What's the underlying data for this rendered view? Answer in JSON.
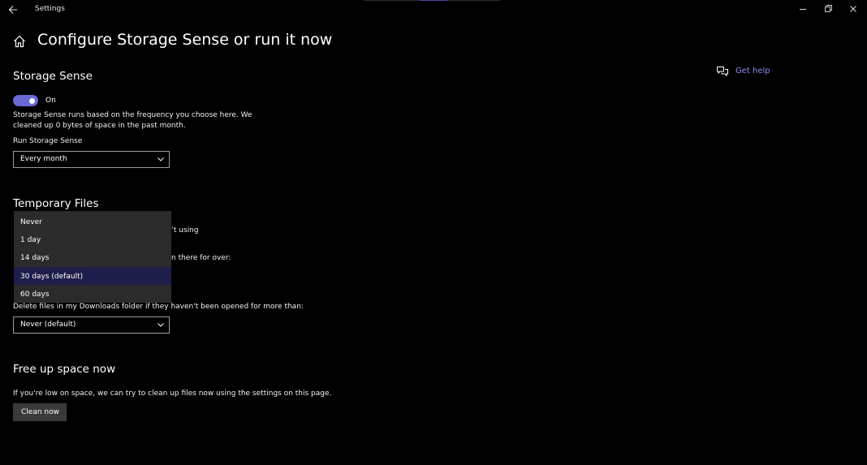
{
  "window": {
    "title": "Settings",
    "back_icon": "back-arrow-icon",
    "minimize_icon": "minimize-icon",
    "restore_icon": "restore-icon",
    "close_icon": "close-icon"
  },
  "header": {
    "home_icon": "home-icon",
    "title": "Configure Storage Sense or run it now"
  },
  "help": {
    "icon": "chat-help-icon",
    "label": "Get help",
    "color": "#8d8df0"
  },
  "storage_sense": {
    "heading": "Storage Sense",
    "toggle_state": "On",
    "toggle_on": true,
    "accent_color": "#6b69d6",
    "description_line1": "Storage Sense runs based on the frequency you choose here. We",
    "description_line2": "cleaned up 0 bytes of space in the past month.",
    "run_label": "Run Storage Sense",
    "run_value": "Every month"
  },
  "temporary_files": {
    "heading": "Temporary Files",
    "partial_text_1": "’t using",
    "partial_text_2": "n there for over:",
    "downloads_label": "Delete files in my Downloads folder if they haven't been opened for more than:",
    "downloads_value": "Never (default)",
    "recycle_options": [
      "Never",
      "1 day",
      "14 days",
      "30 days (default)",
      "60 days"
    ],
    "recycle_selected": "30 days (default)"
  },
  "free_up": {
    "heading": "Free up space now",
    "description": "If you're low on space, we can try to clean up files now using the settings on this page.",
    "button_label": "Clean now"
  }
}
